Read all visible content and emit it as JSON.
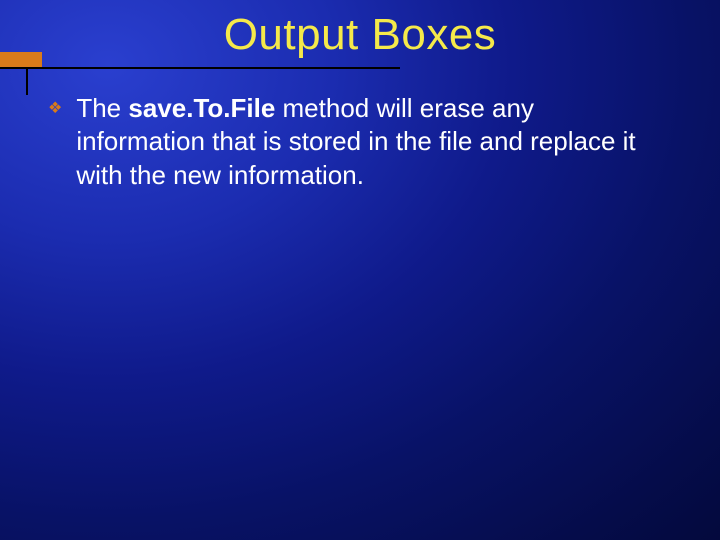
{
  "slide": {
    "title": "Output Boxes",
    "bullet_glyph": "❖",
    "body": {
      "pre": "The ",
      "bold": "save.To.File",
      "post": " method will erase any information that is stored in the file and replace it with the new information."
    }
  }
}
